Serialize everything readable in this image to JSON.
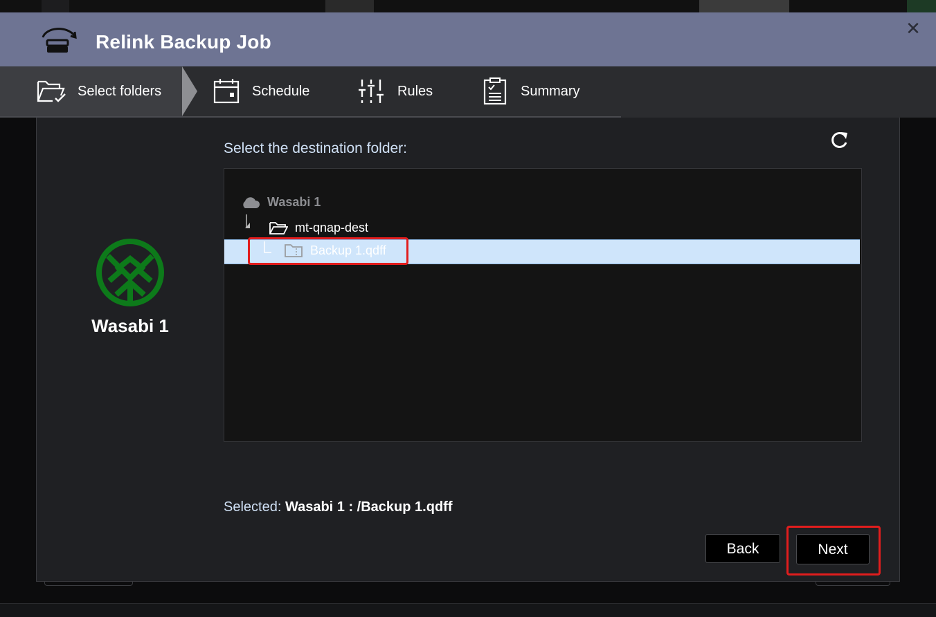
{
  "window": {
    "title": "Relink Backup Job",
    "close_symbol": "✕"
  },
  "steps": [
    {
      "label": "Select folders",
      "icon": "folder-check-icon",
      "active": true
    },
    {
      "label": "Schedule",
      "icon": "calendar-icon",
      "active": false
    },
    {
      "label": "Rules",
      "icon": "sliders-icon",
      "active": false
    },
    {
      "label": "Summary",
      "icon": "clipboard-icon",
      "active": false
    }
  ],
  "source": {
    "name": "Wasabi 1",
    "logo_color": "#0d7a1a"
  },
  "destination": {
    "prompt": "Select the destination folder:",
    "tree": {
      "root": "Wasabi 1",
      "bucket": "mt-qnap-dest",
      "selected_item": "Backup 1.qdff"
    },
    "selected_label": "Selected:",
    "selected_value": "Wasabi 1 : /Backup 1.qdff"
  },
  "buttons": {
    "back": "Back",
    "next": "Next"
  },
  "colors": {
    "titlebar": "#6e7493",
    "selection": "#cfe5fb",
    "highlight": "#e21d1d"
  }
}
